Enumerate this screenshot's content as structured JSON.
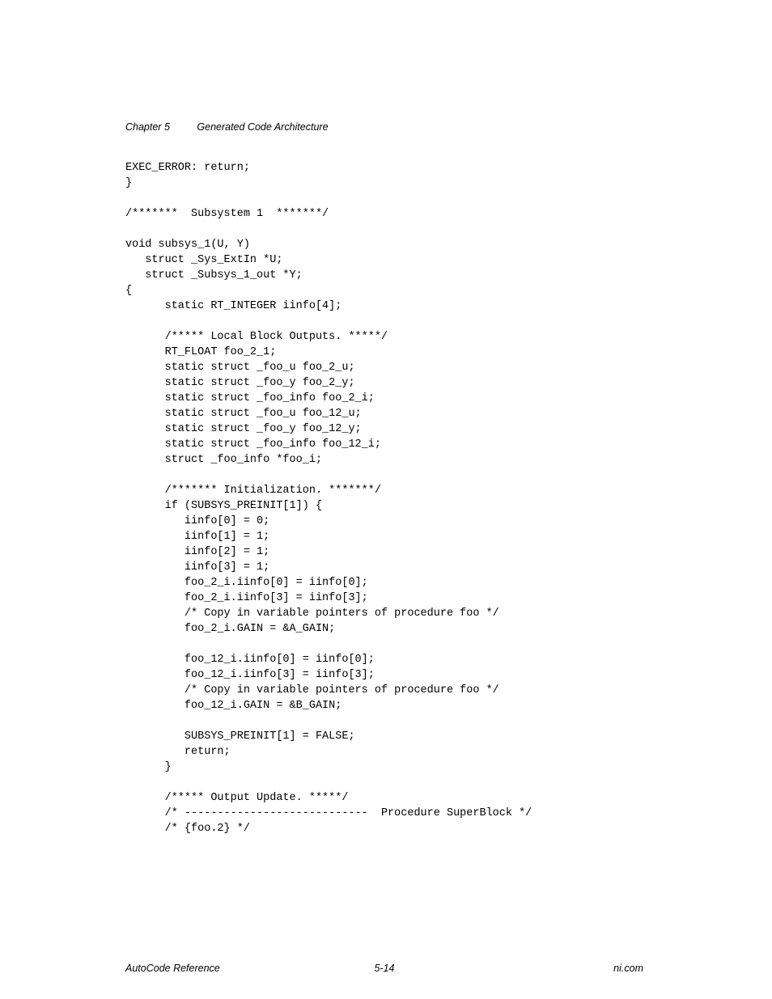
{
  "header": {
    "chapter": "Chapter 5",
    "title": "Generated Code Architecture"
  },
  "code": "EXEC_ERROR: return;\n}\n\n/*******  Subsystem 1  *******/\n\nvoid subsys_1(U, Y)\n   struct _Sys_ExtIn *U;\n   struct _Subsys_1_out *Y;\n{\n      static RT_INTEGER iinfo[4];\n\n      /***** Local Block Outputs. *****/\n      RT_FLOAT foo_2_1;\n      static struct _foo_u foo_2_u;\n      static struct _foo_y foo_2_y;\n      static struct _foo_info foo_2_i;\n      static struct _foo_u foo_12_u;\n      static struct _foo_y foo_12_y;\n      static struct _foo_info foo_12_i;\n      struct _foo_info *foo_i;\n\n      /******* Initialization. *******/\n      if (SUBSYS_PREINIT[1]) {\n         iinfo[0] = 0;\n         iinfo[1] = 1;\n         iinfo[2] = 1;\n         iinfo[3] = 1;\n         foo_2_i.iinfo[0] = iinfo[0];\n         foo_2_i.iinfo[3] = iinfo[3];\n         /* Copy in variable pointers of procedure foo */\n         foo_2_i.GAIN = &A_GAIN;\n\n         foo_12_i.iinfo[0] = iinfo[0];\n         foo_12_i.iinfo[3] = iinfo[3];\n         /* Copy in variable pointers of procedure foo */\n         foo_12_i.GAIN = &B_GAIN;\n\n         SUBSYS_PREINIT[1] = FALSE;\n         return;\n      }\n\n      /***** Output Update. *****/\n      /* ----------------------------  Procedure SuperBlock */\n      /* {foo.2} */",
  "footer": {
    "left": "AutoCode Reference",
    "center": "5-14",
    "right": "ni.com"
  }
}
